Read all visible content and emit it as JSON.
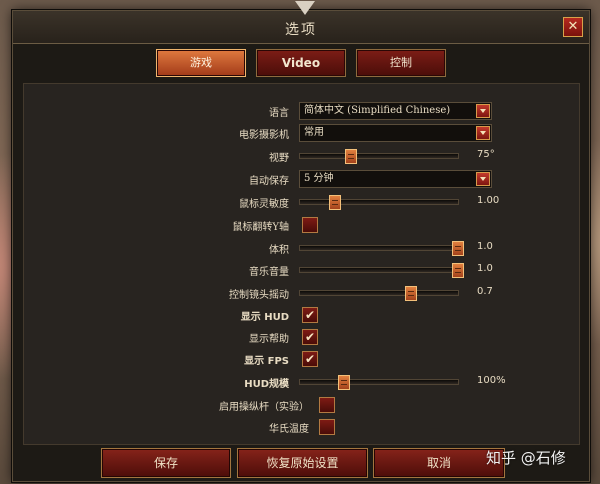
{
  "window": {
    "title": "选项",
    "close_icon": "✕"
  },
  "tabs": [
    {
      "label": "游戏",
      "active": true
    },
    {
      "label": "Video",
      "active": false
    },
    {
      "label": "控制",
      "active": false
    }
  ],
  "settings": {
    "language": {
      "label": "语言",
      "value": "简体中文 (Simplified Chinese)"
    },
    "camera": {
      "label": "电影摄影机",
      "value": "常用"
    },
    "fov": {
      "label": "视野",
      "value": "75°",
      "level": 0.32
    },
    "autosave": {
      "label": "自动保存",
      "value": "5 分钟"
    },
    "mouse_sensitivity": {
      "label": "鼠标灵敏度",
      "value": "1.00",
      "level": 0.22
    },
    "invert_y": {
      "label": "鼠标翻转Y轴",
      "checked": false
    },
    "volume": {
      "label": "体积",
      "value": "1.0",
      "level": 1.0
    },
    "music_volume": {
      "label": "音乐音量",
      "value": "1.0",
      "level": 1.0
    },
    "camera_shake": {
      "label": "控制镜头摇动",
      "value": "0.7",
      "level": 0.7
    },
    "show_hud": {
      "label": "显示 HUD",
      "checked": true
    },
    "show_help": {
      "label": "显示帮助",
      "checked": true
    },
    "show_fps": {
      "label": "显示 FPS",
      "checked": true
    },
    "hud_scale": {
      "label": "HUD规模",
      "value": "100%",
      "level": 0.28
    },
    "joystick": {
      "label": "启用操纵杆（实验）",
      "checked": false
    },
    "fahrenheit": {
      "label": "华氏温度",
      "checked": false
    }
  },
  "footer": {
    "save": "保存",
    "restore": "恢复原始设置",
    "cancel": "取消"
  },
  "watermark": "知乎 @石修",
  "check_glyph": "✔"
}
